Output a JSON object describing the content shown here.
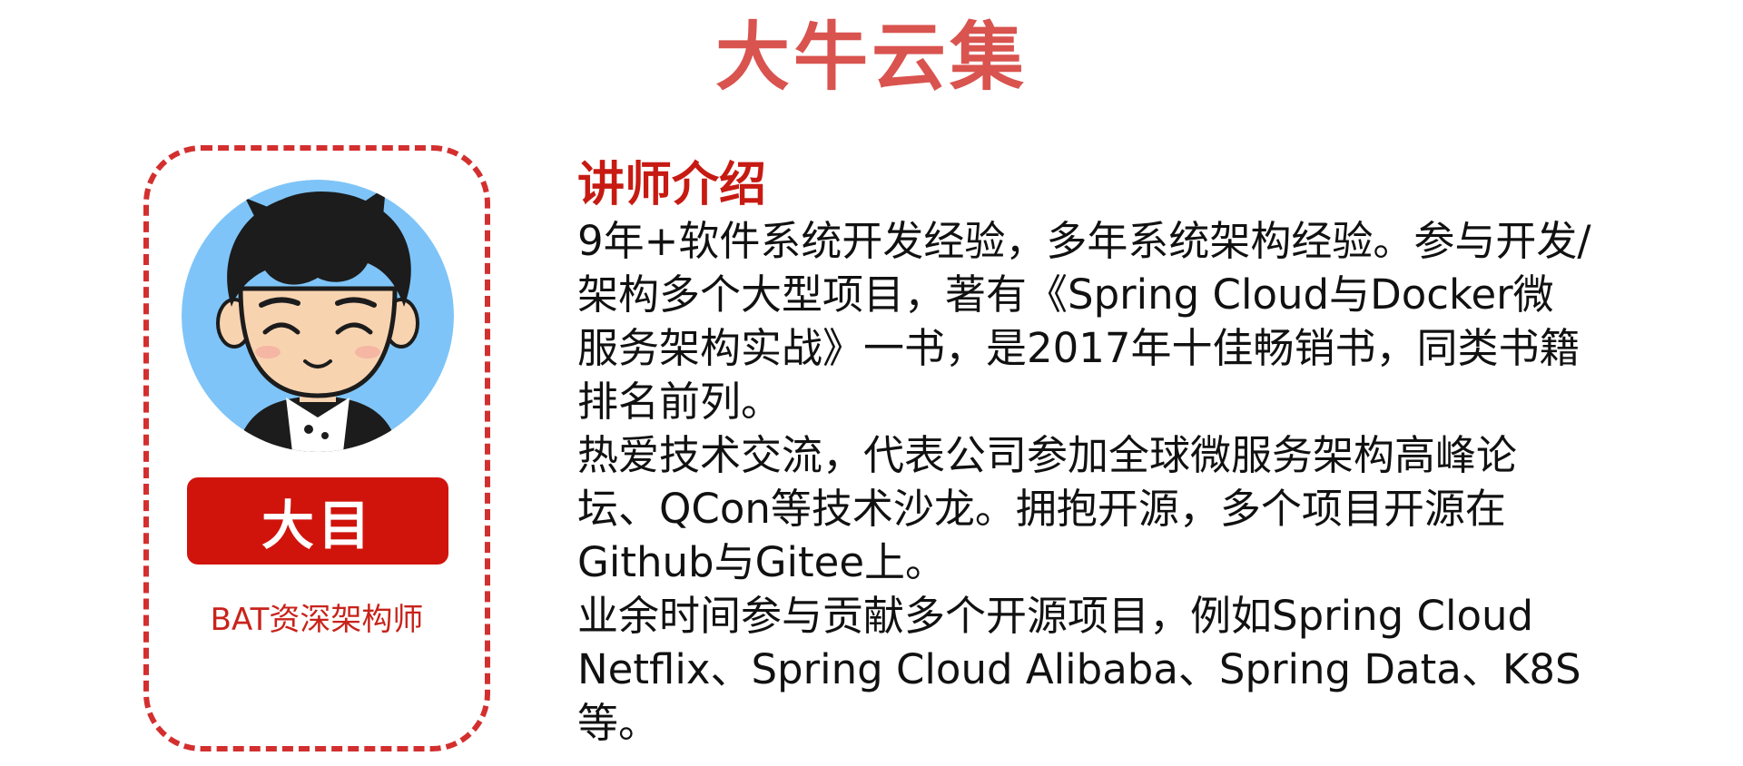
{
  "brand": {
    "title": "大牛云集"
  },
  "profile": {
    "avatar_icon": "cartoon-avatar-icon",
    "name": "大目",
    "role": "BAT资深架构师"
  },
  "intro": {
    "heading": "讲师介绍",
    "paragraphs": [
      "9年+软件系统开发经验，多年系统架构经验。参与开发/架构多个大型项目，著有《Spring Cloud与Docker微服务架构实战》一书，是2017年十佳畅销书，同类书籍排名前列。",
      "热爱技术交流，代表公司参加全球微服务架构高峰论坛、QCon等技术沙龙。拥抱开源，多个项目开源在Github与Gitee上。",
      "业余时间参与贡献多个开源项目，例如Spring Cloud Netflix、Spring Cloud Alibaba、Spring Data、K8S等。"
    ]
  },
  "colors": {
    "brand": "#d9534f",
    "accent_red": "#d0140c",
    "avatar_bg": "#7ec4f8"
  }
}
